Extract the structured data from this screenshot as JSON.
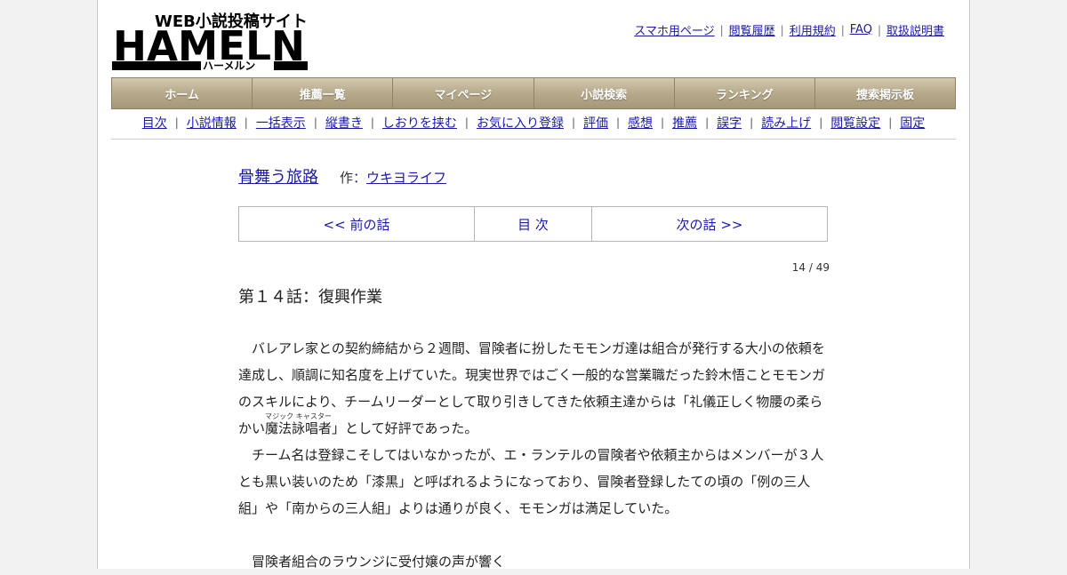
{
  "site": {
    "logo_tagline": "WEB小説投稿サイト",
    "logo_name": "HAMELN",
    "logo_kana": "ハーメルン"
  },
  "top_links": [
    "スマホ用ページ",
    "閲覧履歴",
    "利用規約",
    "FAQ",
    "取扱説明書"
  ],
  "nav": [
    "ホーム",
    "推薦一覧",
    "マイページ",
    "小説検索",
    "ランキング",
    "捜索掲示板"
  ],
  "subnav": [
    "目次",
    "小説情報",
    "一括表示",
    "縦書き",
    "しおりを挟む",
    "お気に入り登録",
    "評価",
    "感想",
    "推薦",
    "誤字",
    "読み上げ",
    "閲覧設定",
    "固定"
  ],
  "novel": {
    "title": "骨舞う旅路",
    "author_label": "作：",
    "author": "ウキヨライフ"
  },
  "pager": {
    "prev": "<< 前の話",
    "toc": "目 次",
    "next": "次の話 >>"
  },
  "page_count": "14 / 49",
  "chapter_title": "第１４話：復興作業",
  "body": {
    "p1_a": "バレアレ家との契約締結から２週間、冒険者に扮したモモンガ達は組合が発行する大小の依頼を達成し、順調に知名度を上げていた。現実世界ではごく一般的な営業職だった鈴木悟ことモモンガのスキルにより、チームリーダーとして取り引きしてきた依頼主達からは「礼儀正しく物腰の柔らかい",
    "p1_ruby_base": "魔法詠唱者",
    "p1_ruby_text": "マジック キャスター",
    "p1_b": "」として好評であった。",
    "p2": "チーム名は登録こそしてはいなかったが、エ・ランテルの冒険者や依頼主からはメンバーが３人とも黒い装いのため「漆黒」と呼ばれるようになっており、冒険者登録したての頃の「例の三人組」や「南からの三人組」よりは通りが良く、モモンガは満足していた。",
    "p3": "冒険者組合のラウンジに受付嬢の声が響く"
  }
}
